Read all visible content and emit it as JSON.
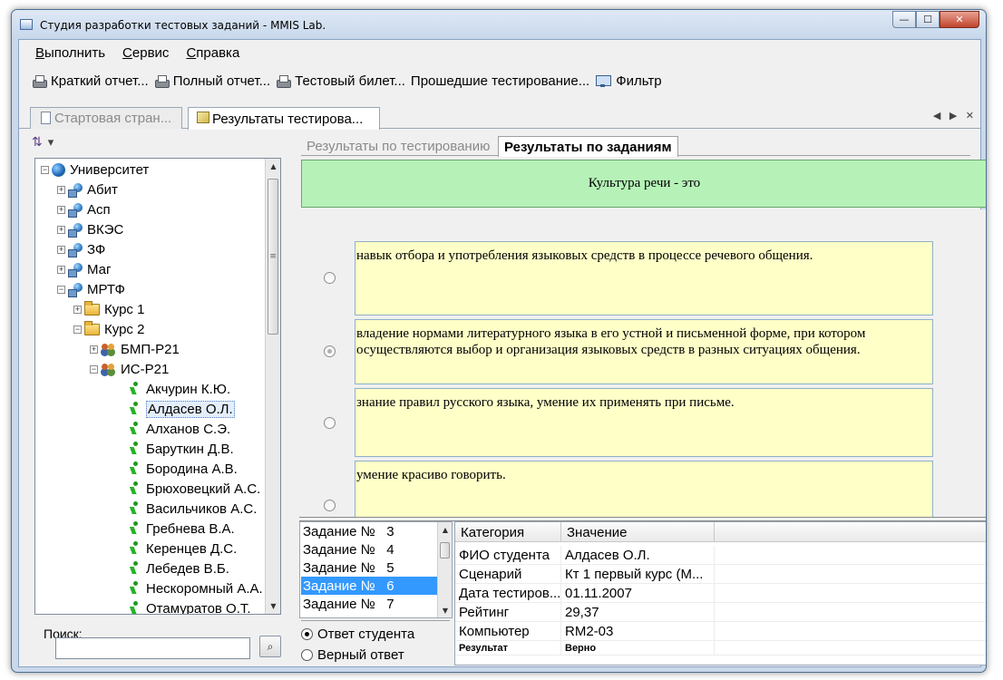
{
  "window": {
    "title": "Студия разработки тестовых заданий - MMIS Lab.",
    "controls": {
      "minimize": "—",
      "maximize": "☐",
      "close": "✕"
    }
  },
  "menubar": {
    "items": [
      {
        "label": "Выполнить",
        "mnemonic": "В",
        "rest": "ыполнить"
      },
      {
        "label": "Сервис",
        "mnemonic": "С",
        "rest": "ервис"
      },
      {
        "label": "Справка",
        "mnemonic": "С",
        "rest": "правка"
      }
    ]
  },
  "toolbar": {
    "items": [
      {
        "label": "Краткий отчет...",
        "icon": "printer-icon"
      },
      {
        "label": "Полный отчет...",
        "icon": "printer-icon"
      },
      {
        "label": "Тестовый билет...",
        "icon": "printer-icon"
      },
      {
        "label": "Прошедшие тестирование...",
        "icon": ""
      },
      {
        "label": "Фильтр",
        "icon": "filter-icon"
      }
    ]
  },
  "doc_tabs": {
    "tab1": "Стартовая стран...",
    "tab2": "Результаты  тестирова...",
    "nav": "◀ ▶ ✕"
  },
  "tree": {
    "toolbar_icon": "sort-icon",
    "toolbar_arrow": "▾",
    "items": [
      {
        "label": "Университет",
        "level": 0,
        "expander": "−",
        "icon": "globe"
      },
      {
        "label": "Абит",
        "level": 1,
        "expander": "+",
        "icon": "net"
      },
      {
        "label": "Асп",
        "level": 1,
        "expander": "+",
        "icon": "net"
      },
      {
        "label": "ВКЭС",
        "level": 1,
        "expander": "+",
        "icon": "net"
      },
      {
        "label": "ЗФ",
        "level": 1,
        "expander": "+",
        "icon": "net"
      },
      {
        "label": "Маг",
        "level": 1,
        "expander": "+",
        "icon": "net"
      },
      {
        "label": "МРТФ",
        "level": 1,
        "expander": "−",
        "icon": "net"
      },
      {
        "label": "Курс 1",
        "level": 2,
        "expander": "+",
        "icon": "folder"
      },
      {
        "label": "Курс 2",
        "level": 2,
        "expander": "−",
        "icon": "folder"
      },
      {
        "label": "БМП-Р21",
        "level": 3,
        "expander": "+",
        "icon": "group"
      },
      {
        "label": "ИС-Р21",
        "level": 3,
        "expander": "−",
        "icon": "group"
      },
      {
        "label": "Акчурин К.Ю.",
        "level": 4,
        "expander": "",
        "icon": "student"
      },
      {
        "label": "Алдасев О.Л.",
        "level": 4,
        "expander": "",
        "icon": "student",
        "selected": true
      },
      {
        "label": "Алханов С.Э.",
        "level": 4,
        "expander": "",
        "icon": "student"
      },
      {
        "label": "Баруткин Д.В.",
        "level": 4,
        "expander": "",
        "icon": "student"
      },
      {
        "label": "Бородина А.В.",
        "level": 4,
        "expander": "",
        "icon": "student"
      },
      {
        "label": "Брюховецкий А.С.",
        "level": 4,
        "expander": "",
        "icon": "student"
      },
      {
        "label": "Васильчиков А.С.",
        "level": 4,
        "expander": "",
        "icon": "student"
      },
      {
        "label": "Гребнева В.А.",
        "level": 4,
        "expander": "",
        "icon": "student"
      },
      {
        "label": "Керенцев Д.С.",
        "level": 4,
        "expander": "",
        "icon": "student"
      },
      {
        "label": "Лебедев В.Б.",
        "level": 4,
        "expander": "",
        "icon": "student"
      },
      {
        "label": "Нескоромный А.А.",
        "level": 4,
        "expander": "",
        "icon": "student"
      },
      {
        "label": "Отамуратов О.Т.",
        "level": 4,
        "expander": "",
        "icon": "student"
      }
    ],
    "scroll": {
      "up": "▲",
      "down": "▼",
      "grip": "≡"
    }
  },
  "search": {
    "label": "Поиск:",
    "value": "",
    "button_glyph": "🔍"
  },
  "results_tabs": {
    "tab1": "Результаты по тестированию",
    "tab2": "Результаты по заданиям"
  },
  "question": {
    "text": "Культура речи - это"
  },
  "answers": [
    {
      "text": "навык отбора и употребления языковых средств в процессе речевого общения.",
      "checked": false
    },
    {
      "text": "владение нормами литературного языка в его устной и письменной форме, при котором осуществляются выбор и организация языковых средств в разных ситуациях общения.",
      "checked": true
    },
    {
      "text": "знание правил русского языка, умение их применять при письме.",
      "checked": false
    },
    {
      "text": "умение красиво говорить.",
      "checked": false
    }
  ],
  "tasks": {
    "items": [
      {
        "label": "Задание №   3",
        "selected": false
      },
      {
        "label": "Задание №   4",
        "selected": false
      },
      {
        "label": "Задание №   5",
        "selected": false
      },
      {
        "label": "Задание №   6",
        "selected": true
      },
      {
        "label": "Задание №   7",
        "selected": false
      }
    ],
    "scroll": {
      "up": "▲",
      "down": "▼"
    }
  },
  "mode": {
    "student_answer": "Ответ студента",
    "correct_answer": "Верный ответ",
    "selected": "student_answer"
  },
  "properties": {
    "headers": {
      "category": "Категория",
      "value": "Значение"
    },
    "rows": [
      {
        "category": "ФИО студента",
        "value": "Алдасев О.Л."
      },
      {
        "category": "Сценарий",
        "value": "Кт 1 первый курс (М..."
      },
      {
        "category": "Дата тестиров...",
        "value": "01.11.2007"
      },
      {
        "category": "Рейтинг",
        "value": "29,37"
      },
      {
        "category": "Компьютер",
        "value": "RM2-03"
      },
      {
        "category": "Результат",
        "value": "Верно",
        "small": true
      }
    ]
  }
}
